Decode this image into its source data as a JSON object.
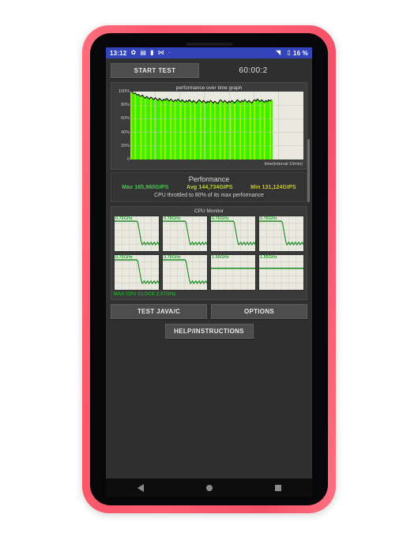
{
  "device": {
    "case_color": "#fa566b",
    "screen_bg": "#303030"
  },
  "status_bar": {
    "time": "13:12",
    "icons": [
      "gear-icon",
      "sim-card-icon",
      "vibrate-icon",
      "bluetooth-icon",
      "dot-icon"
    ],
    "gear_glyph": "✿",
    "sim_glyph": "▤",
    "vibrate_glyph": "▮",
    "bluetooth_glyph": "⋈",
    "dot_glyph": "·",
    "wifi_glyph": "◥",
    "battery_glyph": "▯",
    "battery_percent": "16 %",
    "bg_color": "#3344bb"
  },
  "toolbar": {
    "start_test_label": "START TEST",
    "timer": "60:00:2"
  },
  "performance_panel": {
    "graph_title": "performance over time graph",
    "x_axis_label": "time(interval 10min)",
    "y_ticks": [
      "100%",
      "80%",
      "60%",
      "40%",
      "20%",
      "0"
    ]
  },
  "performance_stats": {
    "title": "Performance",
    "max_label": "Max 165,980GIPS",
    "avg_label": "Avg 144,734GIPS",
    "min_label": "Min 131,124GIPS",
    "max_color": "#3fcf4a",
    "avg_color": "#b8d43a",
    "min_color": "#c9c83a",
    "throttle_note": "CPU throttled to 80% of its max performance"
  },
  "cpu_monitor": {
    "title": "CPU Monitor",
    "cores": [
      {
        "freq": "0.76GHz"
      },
      {
        "freq": "0.76GHz"
      },
      {
        "freq": "0.76GHz"
      },
      {
        "freq": "0.76GHz"
      },
      {
        "freq": "0.76GHz"
      },
      {
        "freq": "0.76GHz"
      },
      {
        "freq": "1.55GHz"
      },
      {
        "freq": "1.55GHz"
      }
    ],
    "max_clock_label": "MAX CPU CLOCK:2.07GHz",
    "trace_color": "#1f8f29"
  },
  "bottom_buttons": {
    "test_java_c": "TEST JAVA/C",
    "options": "OPTIONS",
    "help_instructions": "HELP/INSTRUCTIONS"
  },
  "nav_bar": {
    "back": "back-icon",
    "home": "home-icon",
    "recents": "recents-icon"
  },
  "chart_data": {
    "type": "line",
    "title": "performance over time graph",
    "xlabel": "time(interval 10min)",
    "ylabel": "",
    "ylim": [
      0,
      100
    ],
    "y_ticks": [
      0,
      20,
      40,
      60,
      80,
      100
    ],
    "grid": true,
    "series": [
      {
        "name": "performance %",
        "values": [
          100,
          99,
          97,
          98,
          95,
          96,
          94,
          93,
          95,
          92,
          90,
          93,
          91,
          89,
          92,
          90,
          88,
          91,
          89,
          87,
          90,
          88,
          86,
          89,
          87,
          90,
          88,
          86,
          89,
          87,
          85,
          88,
          86,
          89,
          87,
          85,
          88,
          86,
          84,
          87,
          85,
          88,
          86,
          84,
          87,
          85,
          83,
          86,
          88,
          86,
          84,
          87,
          85,
          83,
          86,
          84,
          87,
          85,
          83,
          86,
          84,
          82,
          85,
          88,
          86,
          84,
          87,
          85,
          83,
          86,
          84,
          87,
          85,
          83,
          86,
          88,
          86,
          84,
          87,
          85,
          88,
          86,
          84,
          87,
          85,
          83,
          86,
          88,
          86,
          89,
          87,
          85,
          88,
          86,
          84,
          87,
          85,
          88,
          86,
          88
        ]
      }
    ],
    "fill_note": "area filled with green gradient stripes from 0 to series value",
    "data_span_fraction": 0.82
  }
}
